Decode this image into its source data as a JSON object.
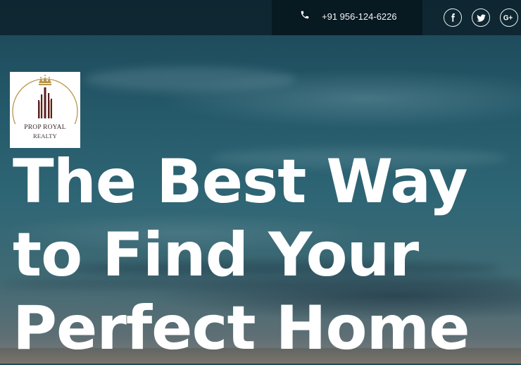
{
  "header": {
    "phone_icon": "phone-icon",
    "phone": "+91 956-124-6226",
    "social": [
      {
        "name": "facebook-icon",
        "glyph": "f"
      },
      {
        "name": "twitter-icon",
        "glyph": "t"
      },
      {
        "name": "google-plus-icon",
        "glyph": "G+"
      }
    ]
  },
  "logo": {
    "line1": "PROP ROYAL",
    "line2": "REALTY",
    "colors": {
      "gold": "#b8954a",
      "maroon": "#5a1f22"
    }
  },
  "hero": {
    "headline_line1": "The Best Way",
    "headline_line2": "to Find Your",
    "headline_line3": "Perfect Home"
  }
}
